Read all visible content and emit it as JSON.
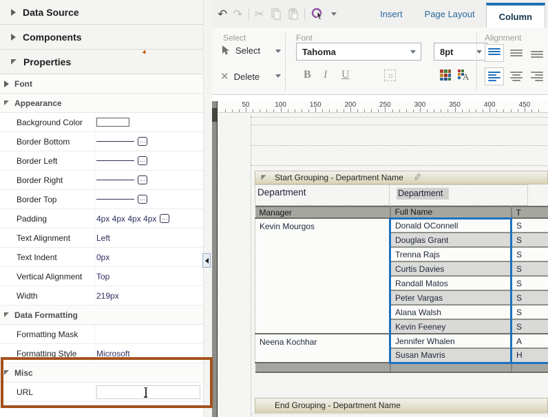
{
  "colors": {
    "selection_blue": "#1b72c0",
    "highlight_box": "#a4511d",
    "tab_accent": "#1d6fb5",
    "header_grey": "#a6a6a0"
  },
  "icons": {
    "undo": "↶",
    "redo": "↷",
    "cut": "✂",
    "delete": "✕",
    "ellipsis": "…",
    "edit_pencil": "✎"
  },
  "left_panel": {
    "accordions": [
      {
        "label": "Data Source",
        "state": "collapsed"
      },
      {
        "label": "Components",
        "state": "collapsed"
      },
      {
        "label": "Properties",
        "state": "expanded"
      }
    ],
    "groups": [
      {
        "label": "Font",
        "state": "collapsed",
        "rows": []
      },
      {
        "label": "Appearance",
        "state": "expanded",
        "rows": [
          {
            "label": "Background Color",
            "type": "swatch",
            "value": "#ffffff"
          },
          {
            "label": "Border Bottom",
            "type": "line"
          },
          {
            "label": "Border Left",
            "type": "line"
          },
          {
            "label": "Border Right",
            "type": "line"
          },
          {
            "label": "Border Top",
            "type": "line"
          },
          {
            "label": "Padding",
            "type": "text-ellipsis",
            "value": "4px 4px 4px 4px"
          },
          {
            "label": "Text Alignment",
            "type": "text",
            "value": "Left"
          },
          {
            "label": "Text Indent",
            "type": "text",
            "value": "0px"
          },
          {
            "label": "Vertical Alignment",
            "type": "text",
            "value": "Top"
          },
          {
            "label": "Width",
            "type": "text",
            "value": "219px"
          }
        ]
      },
      {
        "label": "Data Formatting",
        "state": "expanded",
        "rows": [
          {
            "label": "Formatting Mask",
            "type": "text",
            "value": ""
          },
          {
            "label": "Formatting Style",
            "type": "text",
            "value": "Microsoft"
          }
        ]
      },
      {
        "label": "Misc",
        "state": "expanded",
        "highlighted": true,
        "rows": [
          {
            "label": "URL",
            "type": "input",
            "value": "",
            "placeholder": ""
          }
        ]
      }
    ]
  },
  "toolbar": {
    "quick_icons": [
      {
        "name": "undo",
        "enabled": true
      },
      {
        "name": "redo",
        "enabled": false
      },
      {
        "name": "cut",
        "enabled": false
      },
      {
        "name": "copy",
        "enabled": false
      },
      {
        "name": "paste",
        "enabled": false
      },
      {
        "name": "action-menu",
        "enabled": true
      }
    ],
    "tabs": [
      {
        "label": "Insert",
        "active": false
      },
      {
        "label": "Page Layout",
        "active": false
      },
      {
        "label": "Column",
        "active": true
      }
    ]
  },
  "ribbon": {
    "select_group": {
      "label": "Select",
      "select_button": "Select",
      "delete_button": "Delete"
    },
    "font_group": {
      "label": "Font",
      "font_name": "Tahoma",
      "font_size": "8pt",
      "style_buttons": [
        "B",
        "I",
        "U"
      ]
    },
    "alignment_group": {
      "label": "Alignment",
      "selected_vertical": "top",
      "selected_horizontal": "left"
    }
  },
  "ruler": {
    "unit_labels": [
      50,
      100,
      150,
      200,
      250,
      300,
      350,
      400,
      450
    ]
  },
  "canvas": {
    "start_group_bar": "Start Grouping - Department Name",
    "end_group_bar": "End Grouping - Department Name",
    "department_row": {
      "label": "Department",
      "field": "Department"
    },
    "table": {
      "headers": [
        "Manager",
        "Full Name",
        "T"
      ],
      "selected_column": "Full Name",
      "groups": [
        {
          "manager": "Kevin Mourgos",
          "rows": [
            {
              "full_name": "Donald OConnell",
              "title": "S"
            },
            {
              "full_name": "Douglas Grant",
              "title": "S"
            },
            {
              "full_name": "Trenna Rajs",
              "title": "S"
            },
            {
              "full_name": "Curtis Davies",
              "title": "S"
            },
            {
              "full_name": "Randall Matos",
              "title": "S"
            },
            {
              "full_name": "Peter Vargas",
              "title": "S"
            },
            {
              "full_name": "Alana Walsh",
              "title": "S"
            },
            {
              "full_name": "Kevin Feeney",
              "title": "S"
            }
          ]
        },
        {
          "manager": "Neena Kochhar",
          "rows": [
            {
              "full_name": "Jennifer Whalen",
              "title": "A"
            },
            {
              "full_name": "Susan Mavris",
              "title": "H"
            }
          ]
        }
      ]
    }
  }
}
